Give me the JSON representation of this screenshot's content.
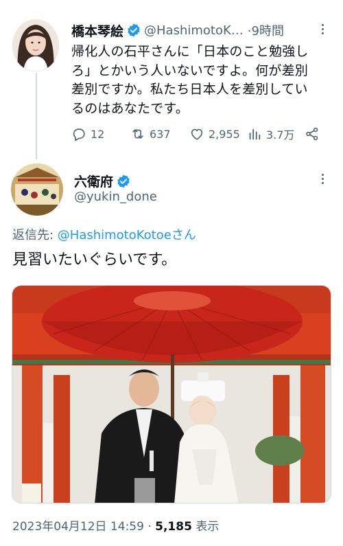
{
  "parent_tweet": {
    "author_name": "橋本琴絵",
    "handle": "@HashimotoK…",
    "time": "·9時間",
    "text_lines": [
      "帰化人の石平さんに「日本のこと勉強し",
      "ろ」とかいう人いないですよ。何が差別",
      "差別ですか。私たち日本人を差別してい",
      "るのはあなたです。"
    ],
    "stats": {
      "replies": "12",
      "retweets": "637",
      "likes": "2,955",
      "views": "3.7万"
    },
    "icons": [
      "verified-badge-icon",
      "more-icon",
      "reply-icon",
      "retweet-icon",
      "like-icon",
      "views-icon",
      "share-icon"
    ]
  },
  "reply_tweet": {
    "author_name": "六衛府",
    "handle": "@yukin_done",
    "replying_prefix": "返信先: ",
    "replying_mention": "@HashimotoKotoe",
    "replying_suffix": "さん",
    "text": "見習いたいぐらいです。",
    "timestamp": "2023年04月12日 14:59 · ",
    "view_count": "5,185",
    "view_suffix": " 表示"
  },
  "colors": {
    "accent": "#1d9bf0",
    "text": "#0f1419",
    "secondary": "#536471",
    "torii_red": "#d8401f",
    "umbrella_red": "#c8261b"
  }
}
